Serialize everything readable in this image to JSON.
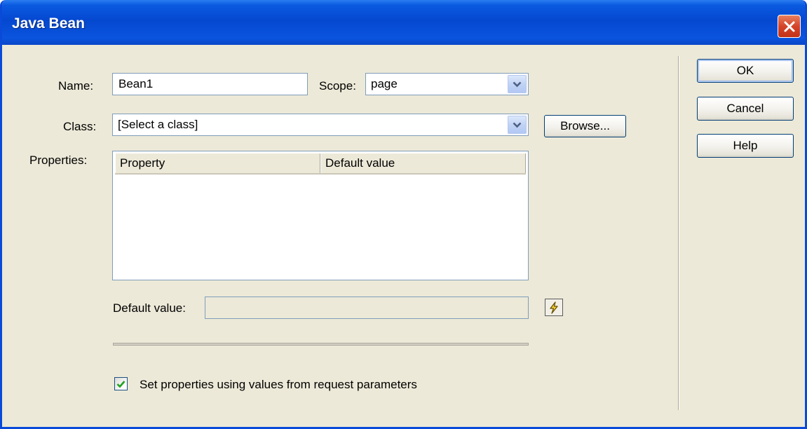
{
  "window": {
    "title": "Java Bean"
  },
  "form": {
    "name_label": "Name:",
    "name_value": "Bean1",
    "scope_label": "Scope:",
    "scope_value": "page",
    "class_label": "Class:",
    "class_value": "[Select a class]",
    "browse_label": "Browse...",
    "properties_label": "Properties:",
    "properties_columns": [
      "Property",
      "Default value"
    ],
    "default_value_label": "Default value:",
    "default_value_value": "",
    "set_properties_label": "Set properties using values from request parameters",
    "set_properties_checked": true
  },
  "buttons": {
    "ok": "OK",
    "cancel": "Cancel",
    "help": "Help"
  },
  "icons": [
    "close-icon",
    "chevron-down-icon",
    "lightning-icon",
    "checkmark-icon"
  ],
  "colors": {
    "titlebar": "#0548d0",
    "close_button": "#d4442a",
    "dialog_bg": "#ece9d8",
    "check": "#21a121"
  }
}
